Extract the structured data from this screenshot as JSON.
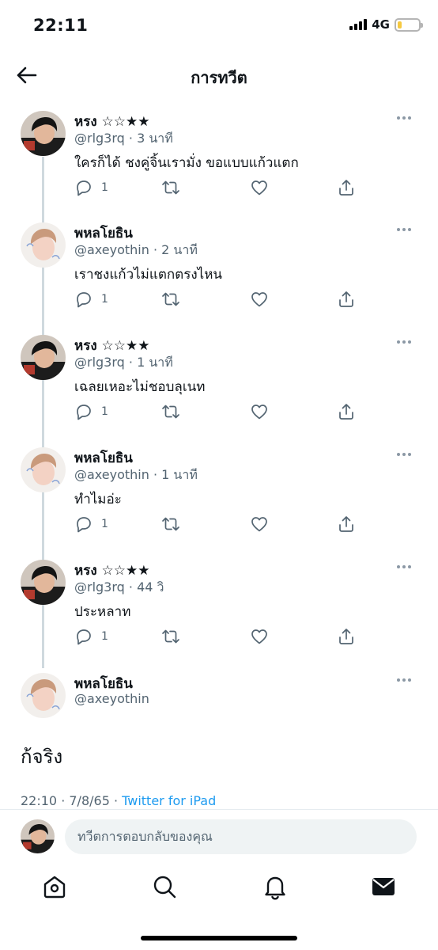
{
  "status_bar": {
    "time": "22:11",
    "network": "4G",
    "battery_level": 0.2
  },
  "header": {
    "title": "การทวีต"
  },
  "replies": [
    {
      "name": "หรง ☆☆★★",
      "handle": "@rlg3rq",
      "time": "3 นาที",
      "text": "ใครก็ได้ ชงคู่จิ้นเรามั่ง ขอแบบแก้วแตก",
      "reply_count": "1",
      "avatar": "boy"
    },
    {
      "name": "พหลโยธิน",
      "handle": "@axeyothin",
      "time": "2 นาที",
      "text": "เราชงแก้วไม่แตกตรงไหน",
      "reply_count": "1",
      "avatar": "idol"
    },
    {
      "name": "หรง ☆☆★★",
      "handle": "@rlg3rq",
      "time": "1 นาที",
      "text": "เฉลยเหอะไม่ชอบลุเนท",
      "reply_count": "1",
      "avatar": "boy"
    },
    {
      "name": "พหลโยธิน",
      "handle": "@axeyothin",
      "time": "1 นาที",
      "text": "ทำไมอ่ะ",
      "reply_count": "1",
      "avatar": "idol"
    },
    {
      "name": "หรง ☆☆★★",
      "handle": "@rlg3rq",
      "time": "44 วิ",
      "text": "ประหลาท",
      "reply_count": "1",
      "avatar": "boy"
    }
  ],
  "main_tweet": {
    "name": "พหลโยธิน",
    "handle": "@axeyothin",
    "text": "ก้จริง",
    "timestamp": "22:10 · 7/8/65 · ",
    "source": "Twitter for iPad"
  },
  "composer": {
    "placeholder": "ทวีตการตอบกลับของคุณ"
  },
  "tabs": [
    "home-icon",
    "search-icon",
    "notifications-icon",
    "messages-icon"
  ],
  "colors": {
    "link": "#1d9bf0",
    "secondary_text": "#536471",
    "thread_line": "#cfd9de"
  }
}
